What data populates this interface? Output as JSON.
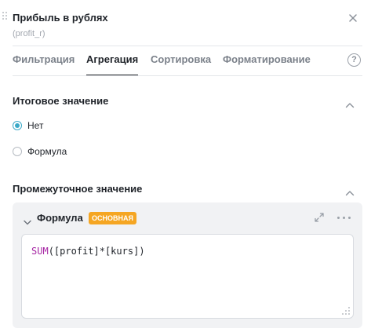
{
  "header": {
    "title": "Прибыль в рублях",
    "subtitle": "(profit_r)"
  },
  "tabs": [
    {
      "label": "Фильтрация",
      "active": false
    },
    {
      "label": "Агрегация",
      "active": true
    },
    {
      "label": "Сортировка",
      "active": false
    },
    {
      "label": "Форматирование",
      "active": false
    }
  ],
  "help_label": "?",
  "total_section": {
    "title": "Итоговое значение",
    "options": [
      {
        "label": "Нет",
        "checked": true
      },
      {
        "label": "Формула",
        "checked": false
      }
    ]
  },
  "intermediate_section": {
    "title": "Промежуточное значение",
    "formula": {
      "title": "Формула",
      "badge": "ОСНОВНАЯ",
      "code_fn": "SUM",
      "code_open": "(",
      "code_field1": "[profit]",
      "code_op": "*",
      "code_field2": "[kurs]",
      "code_close": ")"
    }
  },
  "colors": {
    "accent": "#3aa9c7",
    "badge": "#f5a623",
    "function": "#a626a4"
  }
}
